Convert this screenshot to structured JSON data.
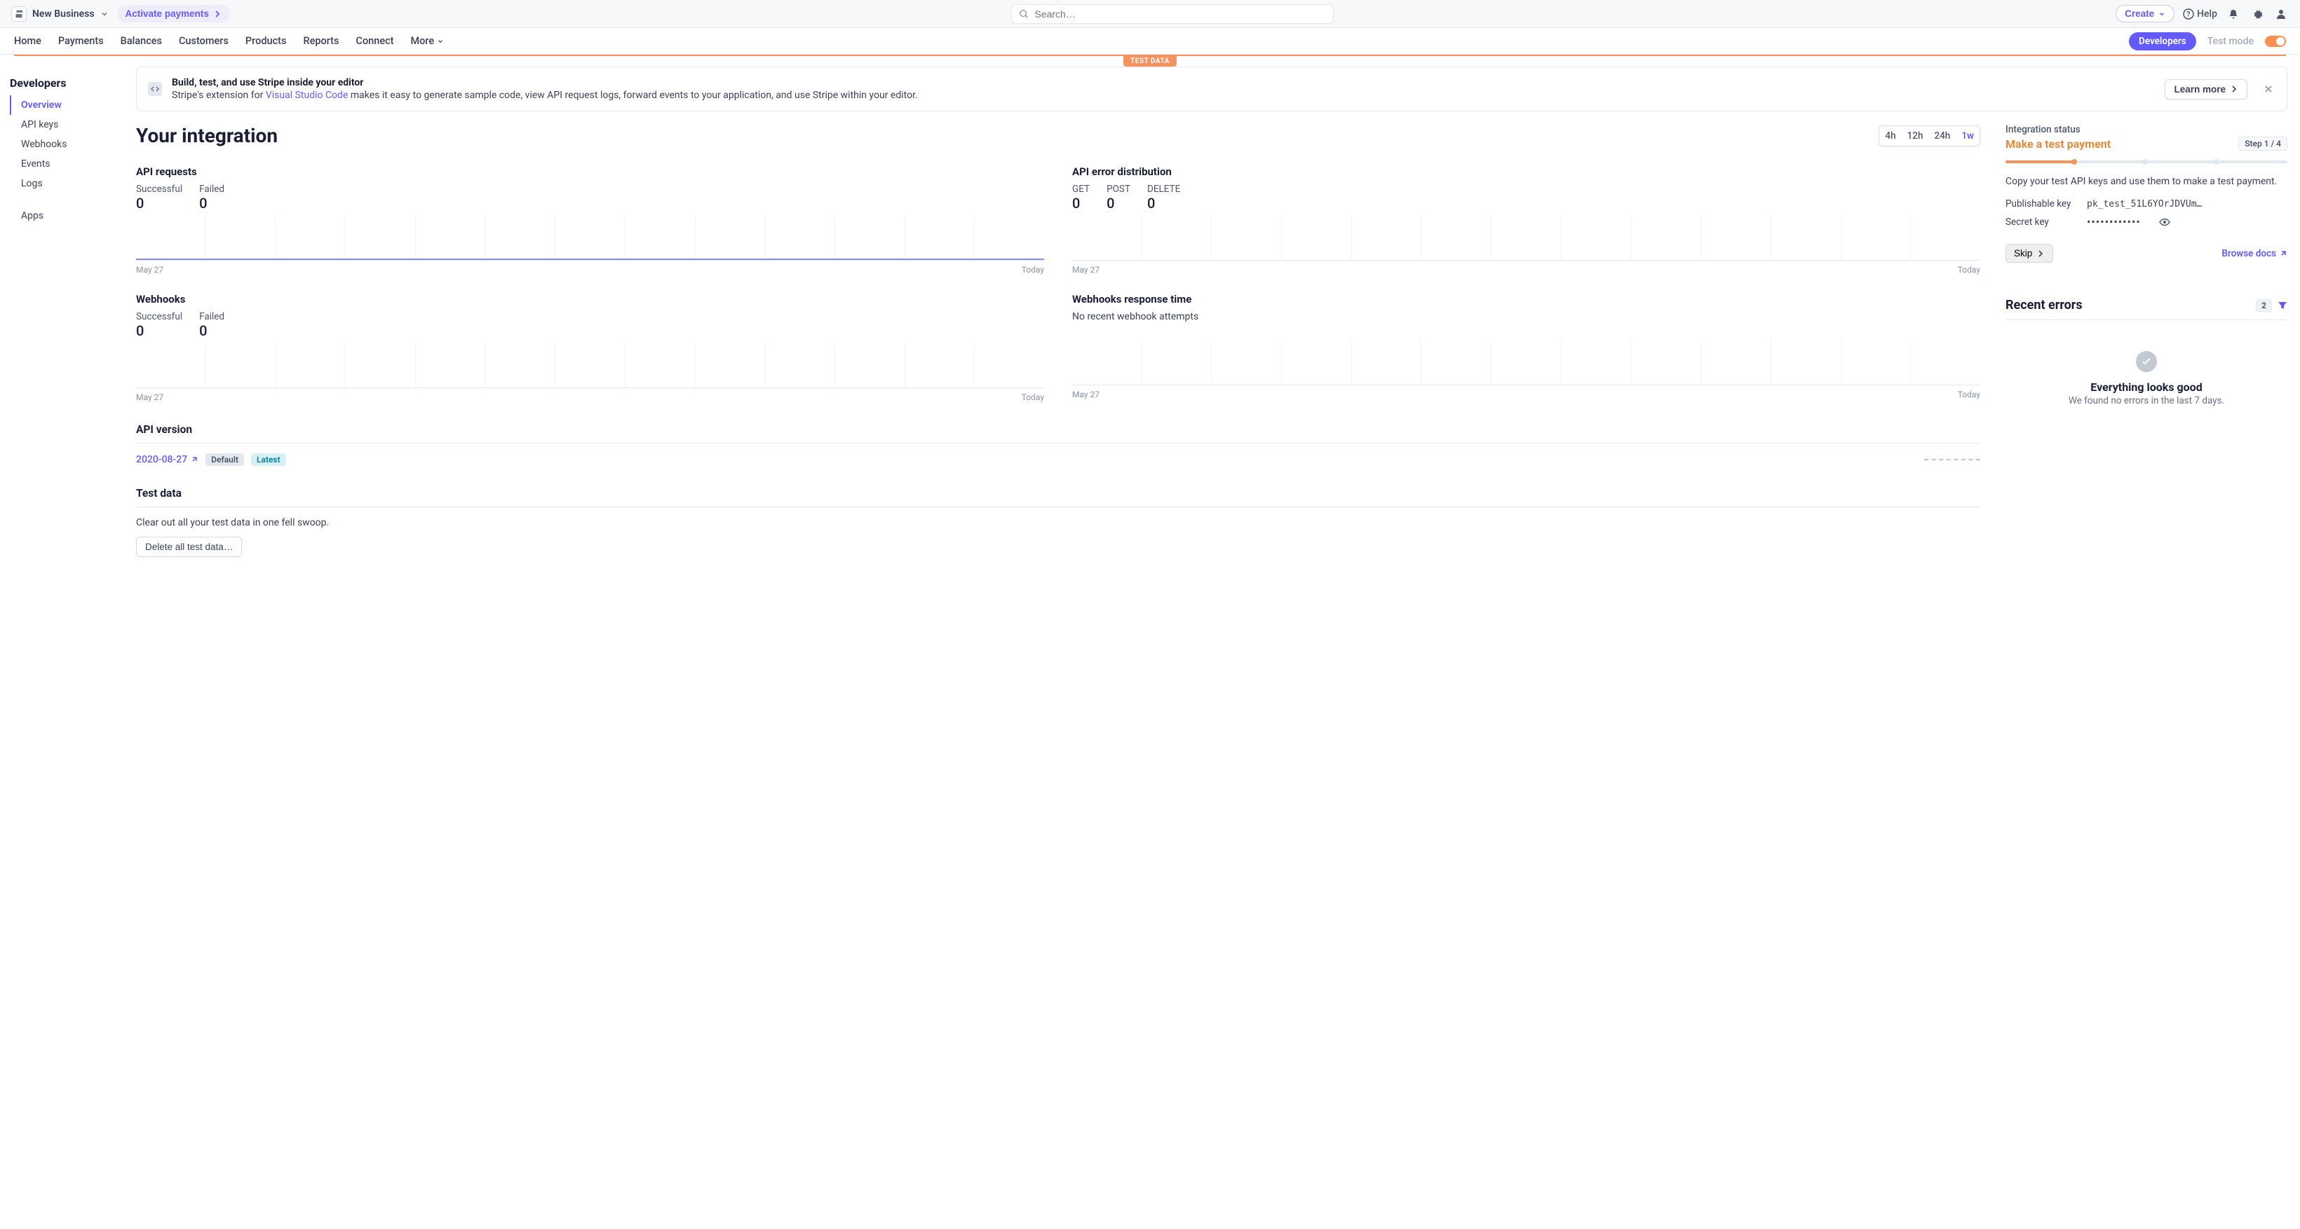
{
  "topbar": {
    "business_name": "New Business",
    "activate_label": "Activate payments",
    "search_placeholder": "Search…",
    "create_label": "Create",
    "help_label": "Help"
  },
  "nav": {
    "items": [
      "Home",
      "Payments",
      "Balances",
      "Customers",
      "Products",
      "Reports",
      "Connect"
    ],
    "more_label": "More",
    "developers_label": "Developers",
    "test_mode_label": "Test mode"
  },
  "test_data_badge": "TEST DATA",
  "sidebar": {
    "title": "Developers",
    "items": [
      "Overview",
      "API keys",
      "Webhooks",
      "Events",
      "Logs"
    ],
    "apps": "Apps"
  },
  "banner": {
    "title": "Build, test, and use Stripe inside your editor",
    "sub_before": "Stripe's extension for ",
    "link": "Visual Studio Code",
    "sub_after": " makes it easy to generate sample code, view API request logs, forward events to your application, and use Stripe within your editor.",
    "learn_label": "Learn more"
  },
  "page_title": "Your integration",
  "range": {
    "r1": "4h",
    "r2": "12h",
    "r3": "24h",
    "r4": "1w"
  },
  "charts": {
    "api_requests": {
      "title": "API requests",
      "s1_label": "Successful",
      "s1_val": "0",
      "s2_label": "Failed",
      "s2_val": "0",
      "from": "May 27",
      "to": "Today"
    },
    "api_errors": {
      "title": "API error distribution",
      "g_label": "GET",
      "g_val": "0",
      "p_label": "POST",
      "p_val": "0",
      "d_label": "DELETE",
      "d_val": "0",
      "from": "May 27",
      "to": "Today"
    },
    "webhooks": {
      "title": "Webhooks",
      "s1_label": "Successful",
      "s1_val": "0",
      "s2_label": "Failed",
      "s2_val": "0",
      "from": "May 27",
      "to": "Today"
    },
    "webhook_time": {
      "title": "Webhooks response time",
      "empty": "No recent webhook attempts",
      "from": "May 27",
      "to": "Today"
    }
  },
  "api_version": {
    "title": "API version",
    "value": "2020-08-27",
    "default_badge": "Default",
    "latest_badge": "Latest"
  },
  "test_data": {
    "title": "Test data",
    "desc": "Clear out all your test data in one fell swoop.",
    "button": "Delete all test data…"
  },
  "status": {
    "label": "Integration status",
    "action": "Make a test payment",
    "step": "Step 1 / 4",
    "desc": "Copy your test API keys and use them to make a test payment.",
    "pub_label": "Publishable key",
    "pub_val": "pk_test_51L6YOrJDVUm…",
    "sec_label": "Secret key",
    "sec_val": "••••••••••••",
    "skip": "Skip",
    "browse": "Browse docs"
  },
  "errors": {
    "title": "Recent errors",
    "count": "2",
    "good": "Everything looks good",
    "sub": "We found no errors in the last 7 days."
  },
  "chart_data": [
    {
      "type": "line",
      "title": "API requests",
      "series": [
        {
          "name": "Successful",
          "values": [
            0,
            0,
            0,
            0,
            0,
            0,
            0
          ]
        },
        {
          "name": "Failed",
          "values": [
            0,
            0,
            0,
            0,
            0,
            0,
            0
          ]
        }
      ],
      "x_range": [
        "May 27",
        "Today"
      ]
    },
    {
      "type": "line",
      "title": "API error distribution",
      "series": [
        {
          "name": "GET",
          "values": [
            0,
            0,
            0,
            0,
            0,
            0,
            0
          ]
        },
        {
          "name": "POST",
          "values": [
            0,
            0,
            0,
            0,
            0,
            0,
            0
          ]
        },
        {
          "name": "DELETE",
          "values": [
            0,
            0,
            0,
            0,
            0,
            0,
            0
          ]
        }
      ],
      "x_range": [
        "May 27",
        "Today"
      ]
    },
    {
      "type": "line",
      "title": "Webhooks",
      "series": [
        {
          "name": "Successful",
          "values": [
            0,
            0,
            0,
            0,
            0,
            0,
            0
          ]
        },
        {
          "name": "Failed",
          "values": [
            0,
            0,
            0,
            0,
            0,
            0,
            0
          ]
        }
      ],
      "x_range": [
        "May 27",
        "Today"
      ]
    },
    {
      "type": "line",
      "title": "Webhooks response time",
      "series": [],
      "note": "No recent webhook attempts",
      "x_range": [
        "May 27",
        "Today"
      ]
    }
  ]
}
